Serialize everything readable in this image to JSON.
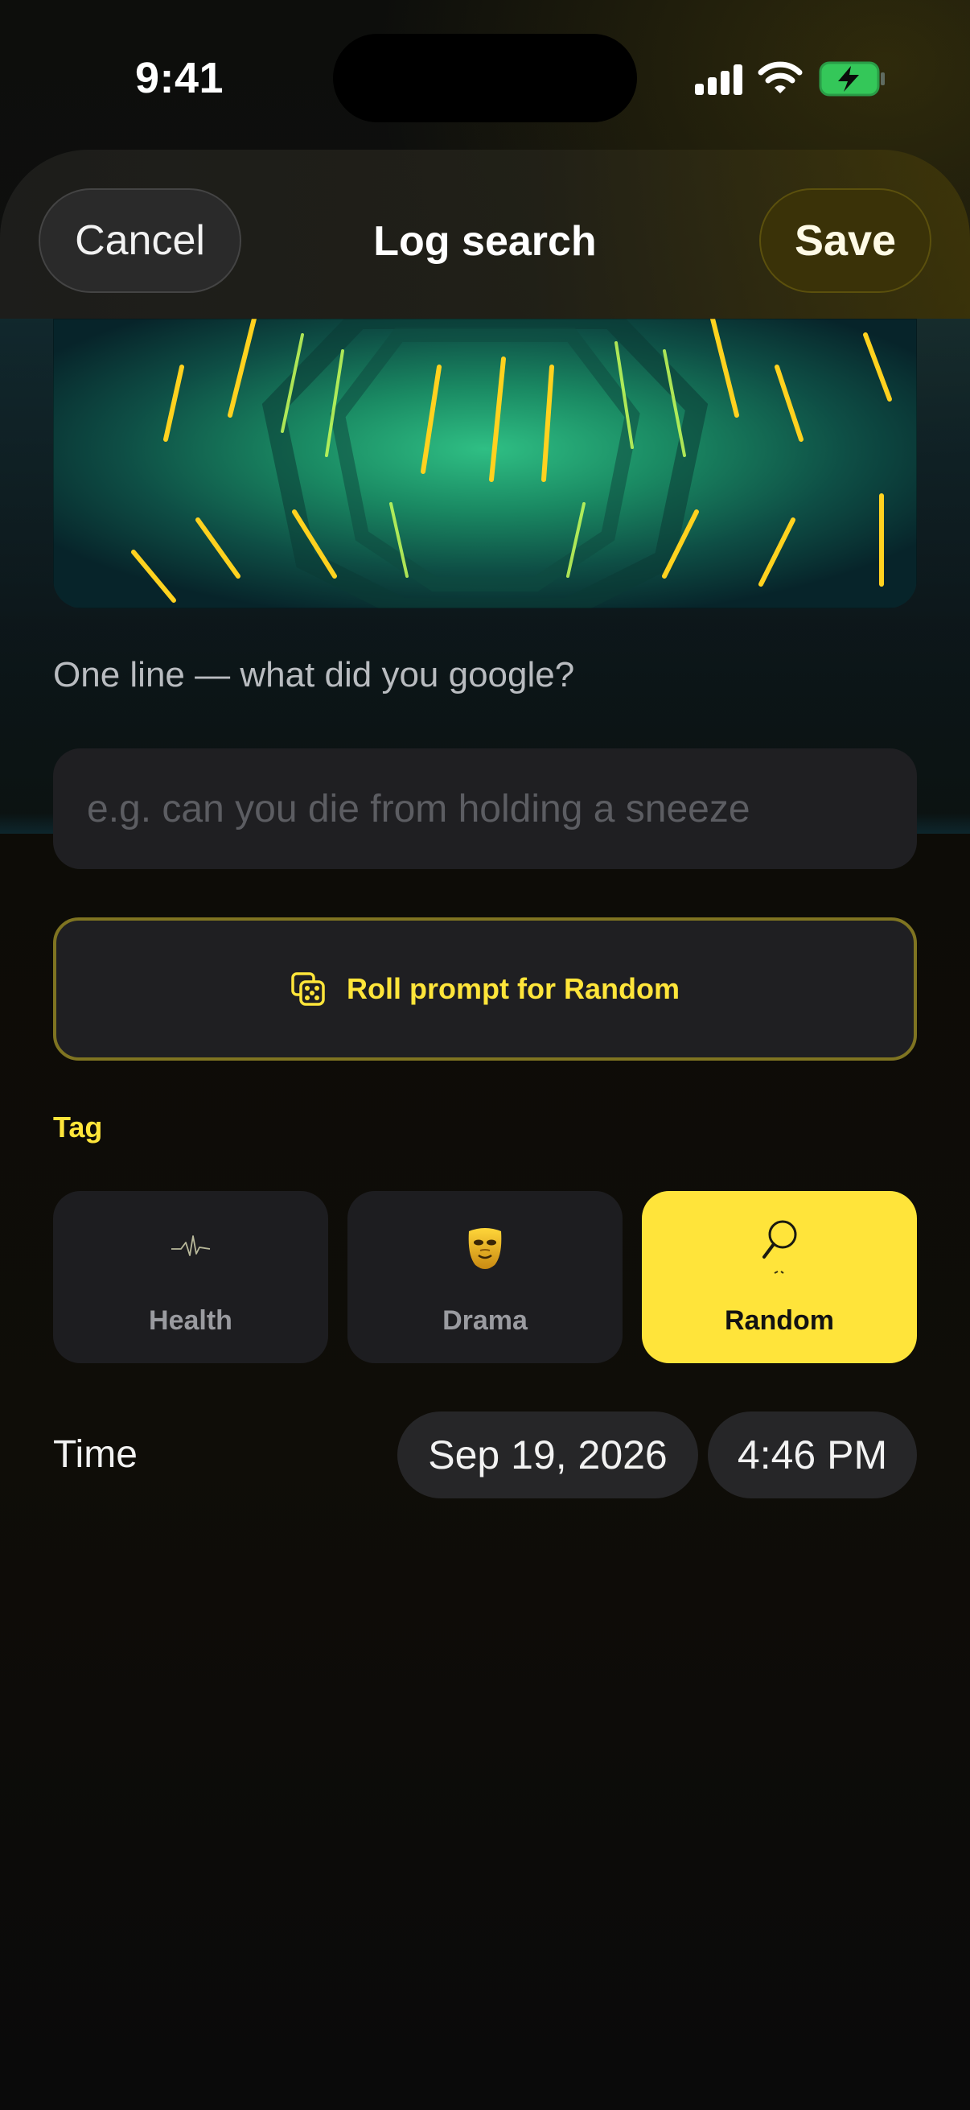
{
  "status_bar": {
    "time": "9:41",
    "icons": [
      "cellular-signal-icon",
      "wifi-icon",
      "battery-charging-icon"
    ],
    "battery_color": "#34c759"
  },
  "nav": {
    "cancel_label": "Cancel",
    "title": "Log search",
    "save_label": "Save"
  },
  "hero": {
    "image": "neon-tunnel-image"
  },
  "search": {
    "label": "One line — what did you google?",
    "placeholder": "e.g. can you die from holding a sneeze",
    "value": ""
  },
  "roll": {
    "label": "Roll prompt for Random",
    "icon": "dice-icon"
  },
  "tags": {
    "label": "Tag",
    "items": [
      {
        "label": "Health",
        "icon": "heartbeat-icon",
        "selected": false
      },
      {
        "label": "Drama",
        "icon": "theater-mask-icon",
        "selected": false
      },
      {
        "label": "Random",
        "icon": "magnifying-glass-icon",
        "selected": true
      }
    ]
  },
  "time": {
    "label": "Time",
    "date": "Sep 19, 2026",
    "clock": "4:46 PM"
  },
  "colors": {
    "accent": "#ffe43a",
    "card": "#1d1d20",
    "background": "#0b0b0a"
  }
}
